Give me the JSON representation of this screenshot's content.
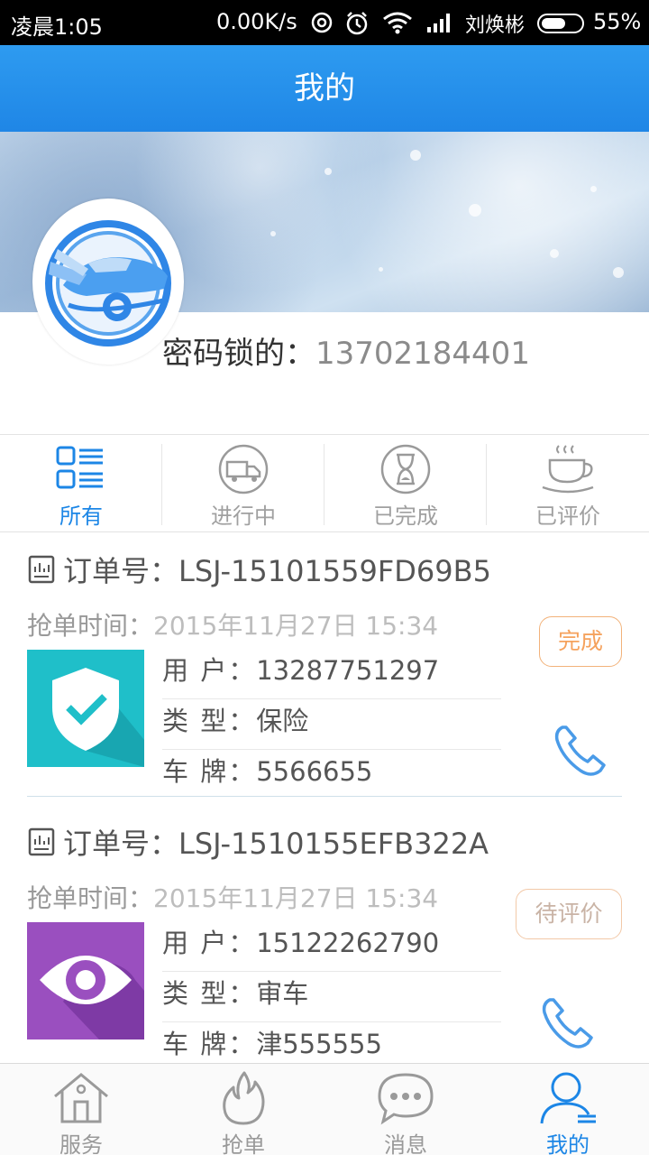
{
  "status_bar": {
    "time": "凌晨1:05",
    "net_speed": "0.00K/s",
    "carrier": "刘焕彬",
    "battery": "55%"
  },
  "header": {
    "title": "我的"
  },
  "profile": {
    "label": "密码锁的：",
    "phone": "13702184401"
  },
  "tabs": [
    {
      "label": "所有",
      "icon": "list-icon",
      "active": true
    },
    {
      "label": "进行中",
      "icon": "truck-icon",
      "active": false
    },
    {
      "label": "已完成",
      "icon": "hourglass-icon",
      "active": false
    },
    {
      "label": "已评价",
      "icon": "coffee-cup-icon",
      "active": false
    }
  ],
  "orders": [
    {
      "order_label": "订单号：",
      "order_no": "LSJ-15101559FD69B5",
      "time_label": "抢单时间：",
      "time": "2015年11月27日 15:34",
      "status": "完成",
      "thumb_icon": "shield-check-icon",
      "rows": [
        {
          "key": "用  户：",
          "value": "13287751297"
        },
        {
          "key": "类  型：",
          "value": "保险"
        },
        {
          "key": "车  牌：",
          "value": "5566655"
        }
      ]
    },
    {
      "order_label": "订单号：",
      "order_no": "LSJ-1510155EFB322A",
      "time_label": "抢单时间：",
      "time": "2015年11月27日 15:34",
      "status": "待评价",
      "thumb_icon": "eye-icon",
      "rows": [
        {
          "key": "用  户：",
          "value": "15122262790"
        },
        {
          "key": "类  型：",
          "value": "审车"
        },
        {
          "key": "车  牌：",
          "value": "津555555"
        }
      ]
    }
  ],
  "bottom_nav": [
    {
      "label": "服务",
      "icon": "home-icon",
      "active": false
    },
    {
      "label": "抢单",
      "icon": "flame-icon",
      "active": false
    },
    {
      "label": "消息",
      "icon": "chat-bubble-icon",
      "active": false
    },
    {
      "label": "我的",
      "icon": "person-icon",
      "active": true
    }
  ],
  "colors": {
    "primary": "#1c86e6",
    "status_orange": "#f5a25d",
    "thumb_teal": "#1fbfc9",
    "thumb_purple": "#8e44ad"
  }
}
